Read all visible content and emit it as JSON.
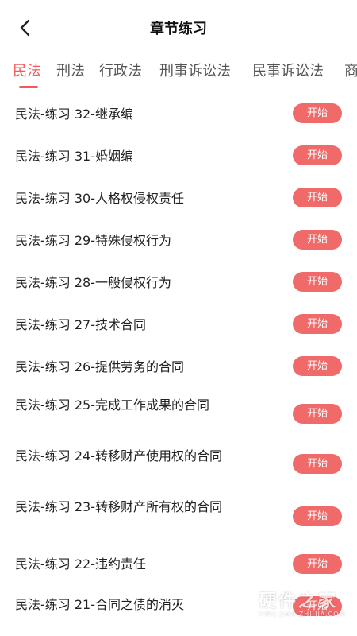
{
  "header": {
    "title": "章节练习",
    "back_icon": "chevron-left-icon"
  },
  "tabs": [
    {
      "label": "民法",
      "active": true
    },
    {
      "label": "刑法",
      "active": false
    },
    {
      "label": "行政法",
      "active": false
    },
    {
      "label": "刑事诉讼法",
      "active": false
    },
    {
      "label": "民事诉讼法",
      "active": false
    },
    {
      "label": "商",
      "active": false
    }
  ],
  "exercises": [
    {
      "title": "民法-练习 32-继承编",
      "button": "开始"
    },
    {
      "title": "民法-练习 31-婚姻编",
      "button": "开始"
    },
    {
      "title": "民法-练习 30-人格权侵权责任",
      "button": "开始"
    },
    {
      "title": "民法-练习 29-特殊侵权行为",
      "button": "开始"
    },
    {
      "title": "民法-练习 28-一般侵权行为",
      "button": "开始"
    },
    {
      "title": "民法-练习 27-技术合同",
      "button": "开始"
    },
    {
      "title": "民法-练习 26-提供劳务的合同",
      "button": "开始"
    },
    {
      "title": "民法-练习 25-完成工作成果的合同",
      "button": "开始"
    },
    {
      "title": "民法-练习 24-转移财产使用权的合同",
      "button": "开始"
    },
    {
      "title": "民法-练习 23-转移财产所有权的合同",
      "button": "开始"
    },
    {
      "title": "民法-练习 22-违约责任",
      "button": "开始"
    },
    {
      "title": "民法-练习 21-合同之债的消灭",
      "button": "开始"
    }
  ],
  "watermark": {
    "text": "硬件之家",
    "subtext": "YING JIAN ZHI JIA.COM"
  },
  "colors": {
    "accent": "#f15a5a",
    "button": "#f06a6a",
    "text": "#222222"
  }
}
